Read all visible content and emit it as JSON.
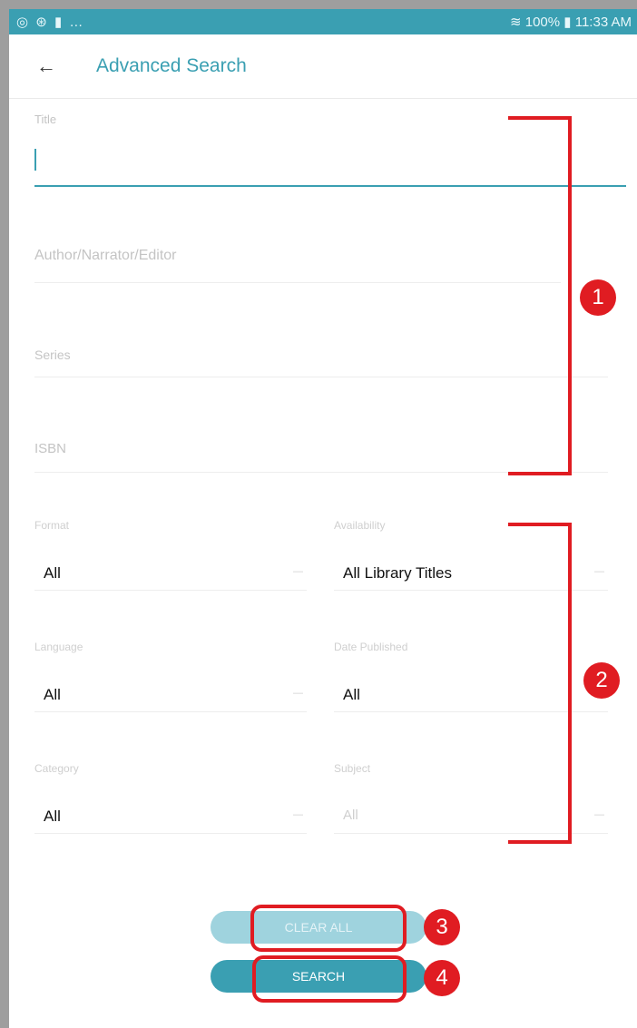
{
  "status_bar": {
    "left_icons": "◎ ⊛ ▮ …",
    "battery": "100%",
    "time": "11:33 AM"
  },
  "header": {
    "title": "Advanced Search"
  },
  "text_fields": {
    "title": {
      "label": "Title",
      "value": ""
    },
    "author": {
      "placeholder": "Author/Narrator/Editor"
    },
    "series": {
      "placeholder": "Series"
    },
    "isbn": {
      "placeholder": "ISBN"
    }
  },
  "filters": {
    "format": {
      "label": "Format",
      "value": "All"
    },
    "availability": {
      "label": "Availability",
      "value": "All Library Titles"
    },
    "language": {
      "label": "Language",
      "value": "All"
    },
    "date_published": {
      "label": "Date Published",
      "value": "All"
    },
    "category": {
      "label": "Category",
      "value": "All"
    },
    "subject": {
      "label": "Subject",
      "value": "All"
    }
  },
  "buttons": {
    "clear_all": "CLEAR ALL",
    "search": "SEARCH"
  },
  "annotations": {
    "b1": "1",
    "b2": "2",
    "b3": "3",
    "b4": "4"
  },
  "colors": {
    "accent": "#3a9fb2",
    "annotation": "#e01c22"
  }
}
